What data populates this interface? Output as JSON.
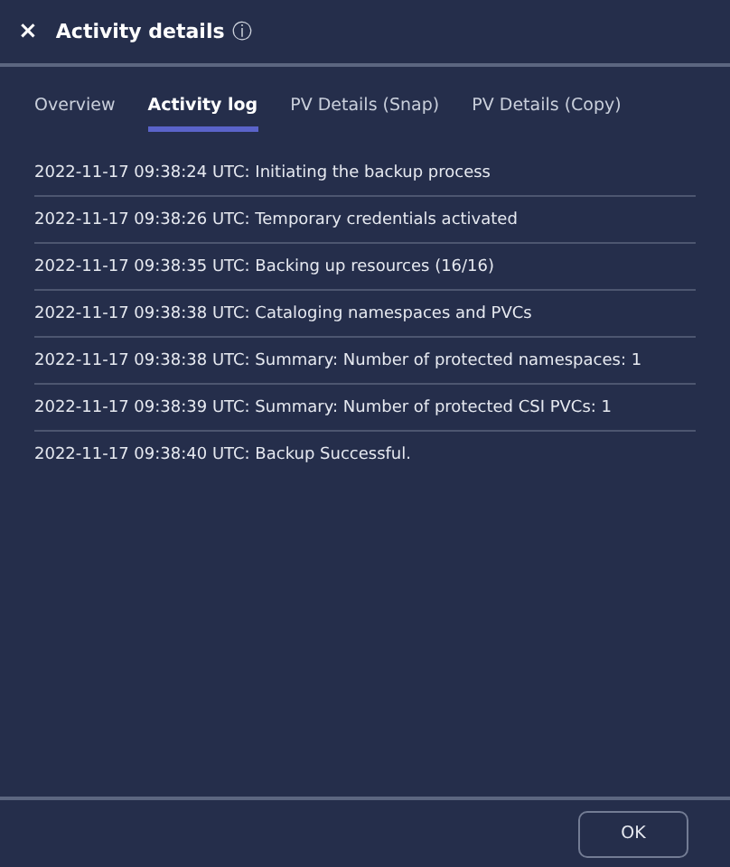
{
  "header": {
    "close": "×",
    "title": "Activity details",
    "info": "ⓘ"
  },
  "tabs": [
    {
      "label": "Overview",
      "selected": false
    },
    {
      "label": "Activity log",
      "selected": true
    },
    {
      "label": "PV Details (Snap)",
      "selected": false
    },
    {
      "label": "PV Details (Copy)",
      "selected": false
    }
  ],
  "log": [
    "2022-11-17 09:38:24 UTC: Initiating the backup process",
    "2022-11-17 09:38:26 UTC: Temporary credentials activated",
    "2022-11-17 09:38:35 UTC: Backing up resources (16/16)",
    "2022-11-17 09:38:38 UTC: Cataloging namespaces and PVCs",
    "2022-11-17 09:38:38 UTC: Summary: Number of protected namespaces: 1",
    "2022-11-17 09:38:39 UTC: Summary: Number of protected CSI PVCs: 1",
    "2022-11-17 09:38:40 UTC: Backup Successful."
  ],
  "buttons": [
    "OK"
  ]
}
